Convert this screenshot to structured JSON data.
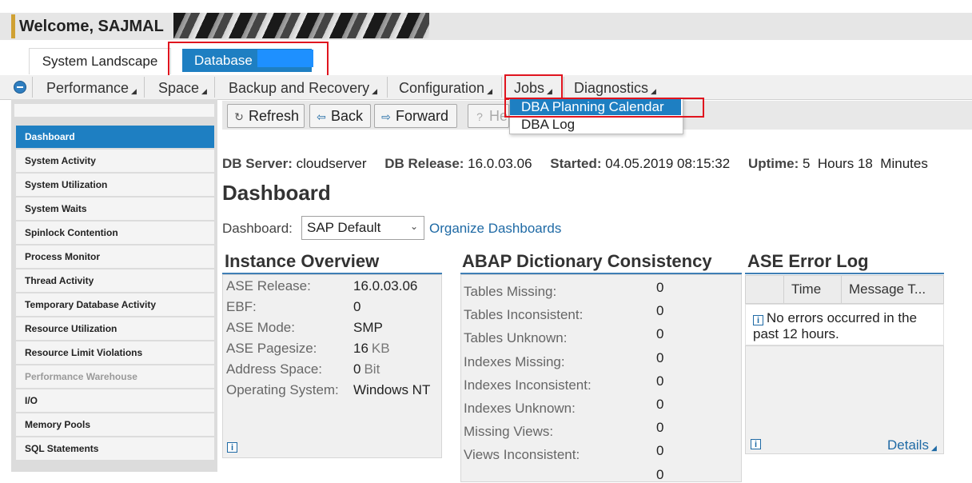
{
  "header": {
    "welcome": "Welcome, SAJMAL"
  },
  "tabs": {
    "system_landscape": "System Landscape",
    "database": "Database"
  },
  "menu": {
    "performance": "Performance",
    "space": "Space",
    "backup": "Backup and Recovery",
    "configuration": "Configuration",
    "jobs": "Jobs",
    "diagnostics": "Diagnostics"
  },
  "jobs_dropdown": {
    "item_1": "DBA Planning Calendar",
    "item_2": "DBA Log"
  },
  "sidebar": {
    "items": [
      {
        "label": "Dashboard",
        "state": "active"
      },
      {
        "label": "System Activity",
        "state": "normal"
      },
      {
        "label": "System Utilization",
        "state": "normal"
      },
      {
        "label": "System Waits",
        "state": "normal"
      },
      {
        "label": "Spinlock Contention",
        "state": "normal"
      },
      {
        "label": "Process Monitor",
        "state": "normal"
      },
      {
        "label": "Thread Activity",
        "state": "normal"
      },
      {
        "label": "Temporary Database Activity",
        "state": "normal"
      },
      {
        "label": "Resource Utilization",
        "state": "normal"
      },
      {
        "label": "Resource Limit Violations",
        "state": "normal"
      },
      {
        "label": "Performance Warehouse",
        "state": "disabled"
      },
      {
        "label": "I/O",
        "state": "normal"
      },
      {
        "label": "Memory Pools",
        "state": "normal"
      },
      {
        "label": "SQL Statements",
        "state": "normal"
      }
    ]
  },
  "toolbar": {
    "refresh": "Refresh",
    "back": "Back",
    "forward": "Forward",
    "help": "Help"
  },
  "server_info": {
    "db_server_label": "DB Server:",
    "db_server": "cloudserver",
    "db_release_label": "DB Release:",
    "db_release": "16.0.03.06",
    "started_label": "Started:",
    "started": "04.05.2019 08:15:32",
    "uptime_label": "Uptime:",
    "uptime": "5  Hours 18  Minutes"
  },
  "page_title": "Dashboard",
  "dashboard_select": {
    "label": "Dashboard:",
    "value": "SAP Default",
    "organize_link": "Organize Dashboards"
  },
  "instance_overview": {
    "title": "Instance Overview",
    "rows": [
      {
        "key": "ASE Release:",
        "value": "16.0.03.06",
        "unit": ""
      },
      {
        "key": "EBF:",
        "value": "0",
        "unit": ""
      },
      {
        "key": "ASE Mode:",
        "value": "SMP",
        "unit": ""
      },
      {
        "key": "ASE Pagesize:",
        "value": "16",
        "unit": "KB"
      },
      {
        "key": "Address Space:",
        "value": "0",
        "unit": "Bit"
      },
      {
        "key": "Operating System:",
        "value": "Windows NT",
        "unit": ""
      }
    ]
  },
  "abap_consistency": {
    "title": "ABAP Dictionary Consistency",
    "rows": [
      {
        "key": "Tables Missing:",
        "value": "0"
      },
      {
        "key": "Tables Inconsistent:",
        "value": "0"
      },
      {
        "key": "Tables Unknown:",
        "value": "0"
      },
      {
        "key": "Indexes Missing:",
        "value": "0"
      },
      {
        "key": "Indexes Inconsistent:",
        "value": "0"
      },
      {
        "key": "Indexes Unknown:",
        "value": "0"
      },
      {
        "key": "Missing Views:",
        "value": "0"
      },
      {
        "key": "Views Inconsistent:",
        "value": "0"
      },
      {
        "key": "",
        "value": "0"
      }
    ]
  },
  "error_log": {
    "title": "ASE Error Log",
    "col_time": "Time",
    "col_message": "Message T...",
    "message": "No errors occurred in the past 12 hours.",
    "details_link": "Details"
  },
  "colors": {
    "accent_blue": "#1e7fc2",
    "highlight_red": "#e0141e",
    "link": "#1f6aa5"
  }
}
